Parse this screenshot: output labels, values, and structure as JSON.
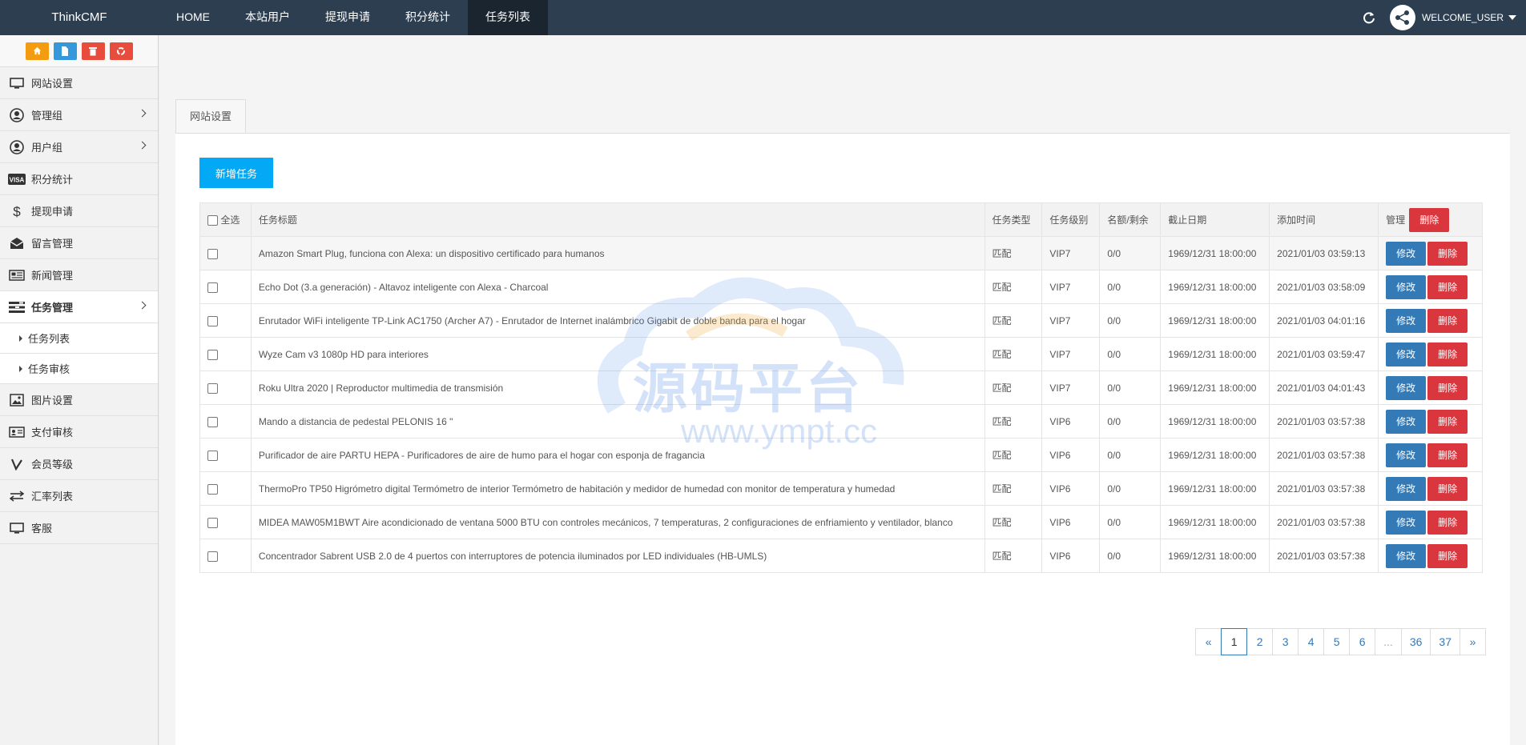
{
  "brand": "ThinkCMF",
  "topnav": [
    {
      "label": "HOME"
    },
    {
      "label": "本站用户"
    },
    {
      "label": "提现申请"
    },
    {
      "label": "积分统计"
    },
    {
      "label": "任务列表",
      "active": true
    }
  ],
  "user": {
    "welcome": "WELCOME_USER"
  },
  "sidebar": {
    "items": [
      {
        "label": "网站设置",
        "icon": "monitor-icon"
      },
      {
        "label": "管理组",
        "icon": "user-circle-icon",
        "chevron": true
      },
      {
        "label": "用户组",
        "icon": "user-icon",
        "chevron": true
      },
      {
        "label": "积分统计",
        "icon": "visa-icon"
      },
      {
        "label": "提现申请",
        "icon": "dollar-icon"
      },
      {
        "label": "留言管理",
        "icon": "envelope-icon"
      },
      {
        "label": "新闻管理",
        "icon": "newspaper-icon"
      },
      {
        "label": "任务管理",
        "icon": "tasks-icon",
        "chevron": true,
        "active": true
      },
      {
        "label": "图片设置",
        "icon": "image-icon"
      },
      {
        "label": "支付审核",
        "icon": "id-card-icon"
      },
      {
        "label": "会员等级",
        "icon": "vip-icon"
      },
      {
        "label": "汇率列表",
        "icon": "exchange-icon"
      },
      {
        "label": "客服",
        "icon": "desktop-icon"
      }
    ],
    "subitems": [
      {
        "label": "任务列表"
      },
      {
        "label": "任务审核"
      }
    ]
  },
  "tab": {
    "label": "网站设置"
  },
  "add_button": "新增任务",
  "table": {
    "headers": {
      "select_all": "全选",
      "title": "任务标题",
      "type": "任务类型",
      "level": "任务级别",
      "quota": "名额/剩余",
      "deadline": "截止日期",
      "added": "添加时间",
      "manage": "管理",
      "delete": "删除"
    },
    "edit_label": "修改",
    "delete_label": "删除",
    "rows": [
      {
        "title": "Amazon Smart Plug, funciona con Alexa: un dispositivo certificado para humanos",
        "type": "匹配",
        "level": "VIP7",
        "quota": "0/0",
        "deadline": "1969/12/31 18:00:00",
        "added": "2021/01/03 03:59:13"
      },
      {
        "title": "Echo Dot (3.a generación) - Altavoz inteligente con Alexa - Charcoal",
        "type": "匹配",
        "level": "VIP7",
        "quota": "0/0",
        "deadline": "1969/12/31 18:00:00",
        "added": "2021/01/03 03:58:09"
      },
      {
        "title": "Enrutador WiFi inteligente TP-Link AC1750 (Archer A7) - Enrutador de Internet inalámbrico Gigabit de doble banda para el hogar",
        "type": "匹配",
        "level": "VIP7",
        "quota": "0/0",
        "deadline": "1969/12/31 18:00:00",
        "added": "2021/01/03 04:01:16"
      },
      {
        "title": "Wyze Cam v3 1080p HD para interiores",
        "type": "匹配",
        "level": "VIP7",
        "quota": "0/0",
        "deadline": "1969/12/31 18:00:00",
        "added": "2021/01/03 03:59:47"
      },
      {
        "title": "Roku Ultra 2020 | Reproductor multimedia de transmisión",
        "type": "匹配",
        "level": "VIP7",
        "quota": "0/0",
        "deadline": "1969/12/31 18:00:00",
        "added": "2021/01/03 04:01:43"
      },
      {
        "title": "Mando a distancia de pedestal PELONIS 16 \"",
        "type": "匹配",
        "level": "VIP6",
        "quota": "0/0",
        "deadline": "1969/12/31 18:00:00",
        "added": "2021/01/03 03:57:38"
      },
      {
        "title": "Purificador de aire PARTU HEPA - Purificadores de aire de humo para el hogar con esponja de fragancia",
        "type": "匹配",
        "level": "VIP6",
        "quota": "0/0",
        "deadline": "1969/12/31 18:00:00",
        "added": "2021/01/03 03:57:38"
      },
      {
        "title": "ThermoPro TP50 Higrómetro digital Termómetro de interior Termómetro de habitación y medidor de humedad con monitor de temperatura y humedad",
        "type": "匹配",
        "level": "VIP6",
        "quota": "0/0",
        "deadline": "1969/12/31 18:00:00",
        "added": "2021/01/03 03:57:38"
      },
      {
        "title": "MIDEA MAW05M1BWT Aire acondicionado de ventana 5000 BTU con controles mecánicos, 7 temperaturas, 2 configuraciones de enfriamiento y ventilador, blanco",
        "type": "匹配",
        "level": "VIP6",
        "quota": "0/0",
        "deadline": "1969/12/31 18:00:00",
        "added": "2021/01/03 03:57:38"
      },
      {
        "title": "Concentrador Sabrent USB 2.0 de 4 puertos con interruptores de potencia iluminados por LED individuales (HB-UMLS)",
        "type": "匹配",
        "level": "VIP6",
        "quota": "0/0",
        "deadline": "1969/12/31 18:00:00",
        "added": "2021/01/03 03:57:38"
      }
    ]
  },
  "pagination": {
    "prev": "«",
    "next": "»",
    "pages": [
      "1",
      "2",
      "3",
      "4",
      "5",
      "6",
      "...",
      "36",
      "37"
    ],
    "current": "1"
  },
  "watermark": {
    "text": "源码平台",
    "url": "www.ympt.cc"
  },
  "colors": {
    "navbar": "#2c3e50",
    "primary": "#337ab7",
    "danger": "#d9363e",
    "add": "#03a9f4"
  }
}
